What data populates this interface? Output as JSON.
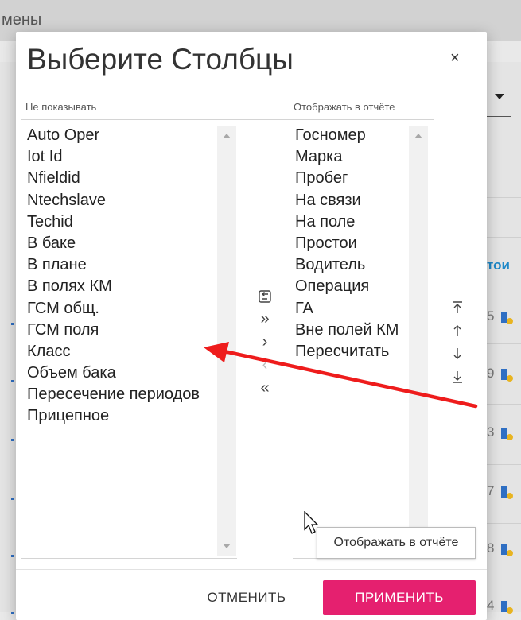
{
  "background": {
    "topbar_text": "мены",
    "side_link": "тои",
    "row_numbers": [
      "5",
      "9",
      "3",
      "7",
      "8",
      "4"
    ]
  },
  "dialog": {
    "title": "Выберите Столбцы",
    "close_symbol": "×",
    "hidden_label": "Не показывать",
    "shown_label": "Отображать в отчёте",
    "hidden_items": [
      "Auto Oper",
      "Iot Id",
      "Nfieldid",
      "Ntechslave",
      "Techid",
      "В баке",
      "В плане",
      "В полях КМ",
      "ГСМ общ.",
      "ГСМ поля",
      "Класс",
      "Объем бака",
      "Пересечение периодов",
      "Прицепное"
    ],
    "shown_items": [
      "Госномер",
      "Марка",
      "Пробег",
      "На связи",
      "На поле",
      "Простои",
      "Водитель",
      "Операция",
      "ГА",
      "Вне полей КМ",
      "Пересчитать"
    ],
    "controls": {
      "swap_icon": "swap-icon",
      "move_all_right": "»",
      "move_right": "›",
      "move_left": "‹",
      "move_all_left": "«"
    },
    "cancel_label": "ОТМЕНИТЬ",
    "apply_label": "ПРИМЕНИТЬ",
    "tooltip": "Отображать в отчёте",
    "accent_color": "#e5206f"
  }
}
